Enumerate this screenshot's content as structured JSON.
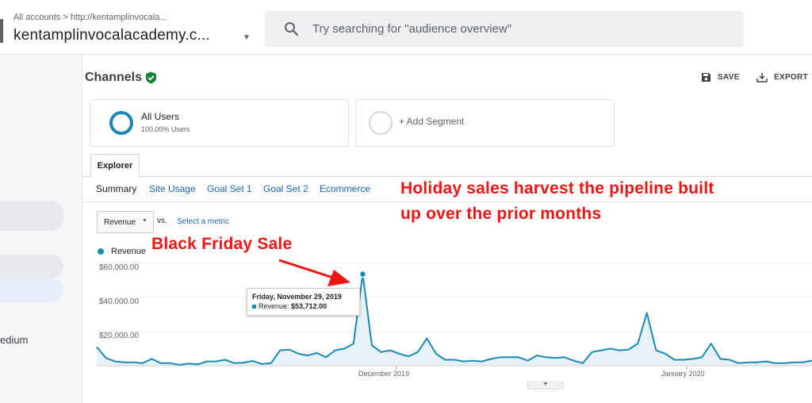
{
  "header": {
    "breadcrumb": "All accounts > http://kentamplinvocala...",
    "account": "kentamplinvocalacademy.c...",
    "search_placeholder": "Try searching for \"audience overview\""
  },
  "sidebar": {
    "partial_label": "edium"
  },
  "report": {
    "title": "Channels",
    "save_label": "SAVE",
    "export_label": "EXPORT"
  },
  "segments": [
    {
      "title": "All Users",
      "subtitle": "100.00% Users"
    },
    {
      "title": "+ Add Segment"
    }
  ],
  "explorer": {
    "tab": "Explorer",
    "subtabs": [
      "Summary",
      "Site Usage",
      "Goal Set 1",
      "Goal Set 2",
      "Ecommerce"
    ]
  },
  "metric": {
    "selected": "Revenue",
    "vs": "vs.",
    "select_metric": "Select a metric"
  },
  "chart_data": {
    "type": "area",
    "series": [
      {
        "name": "Revenue",
        "values": [
          11000,
          4500,
          2500,
          2000,
          2000,
          1500,
          4000,
          1500,
          1500,
          500,
          1200,
          800,
          2500,
          2500,
          3500,
          1500,
          1800,
          2800,
          1000,
          1500,
          9000,
          9500,
          7000,
          6000,
          7500,
          5000,
          9000,
          10000,
          13000,
          53712,
          12000,
          8000,
          9000,
          7000,
          5500,
          8000,
          16000,
          7000,
          3500,
          3500,
          2500,
          3000,
          2500,
          4000,
          5000,
          5000,
          5000,
          3000,
          6000,
          5000,
          4500,
          5000,
          3000,
          1500,
          8000,
          9000,
          10000,
          9000,
          9500,
          13000,
          31000,
          9000,
          7000,
          3500,
          3500,
          4000,
          5000,
          13000,
          4000,
          3500,
          1500,
          2000,
          2000,
          2500,
          1500,
          1500,
          2000,
          2000,
          3000
        ]
      }
    ],
    "x_labels": [
      "December 2019",
      "January 2020"
    ],
    "y_ticks": [
      "$60,000.00",
      "$40,000.00",
      "$20,000.00"
    ],
    "ylim": [
      0,
      60000
    ],
    "legend": "top-left",
    "color": "#1a8ab4",
    "fill": "#e6f2f7"
  },
  "tooltip": {
    "date": "Friday, November 29, 2019",
    "label": "Revenue: ",
    "value": "$53,712.00"
  },
  "annotations": {
    "headline_line1": "Holiday sales harvest the pipeline built",
    "headline_line2": "up over the prior months",
    "callout": "Black Friday Sale"
  }
}
